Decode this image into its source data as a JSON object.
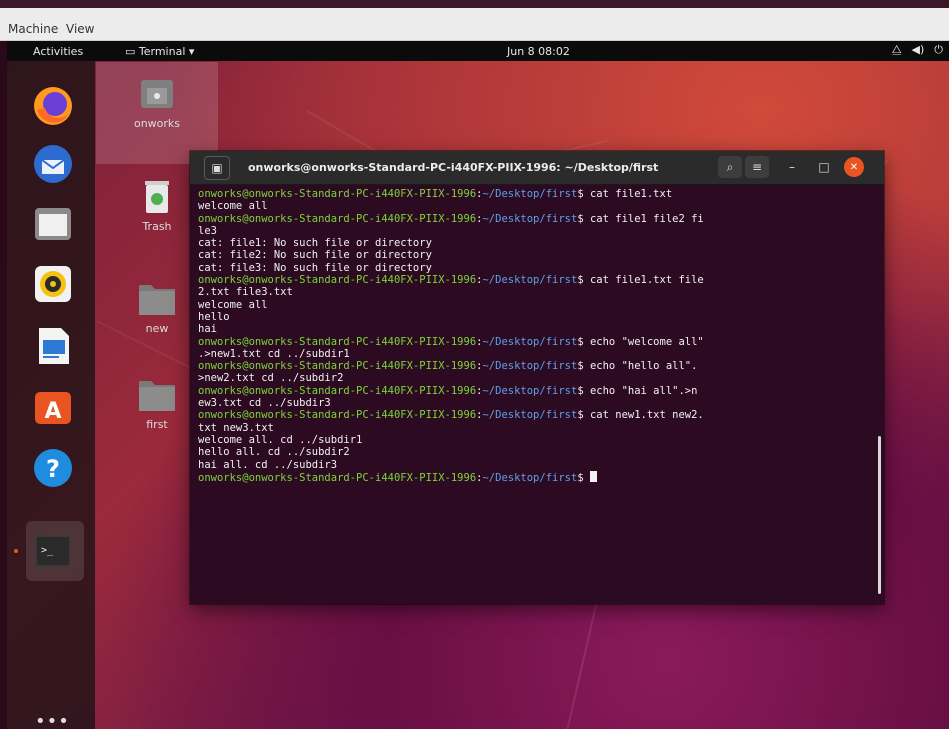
{
  "host_menu": {
    "machine": "Machine",
    "view": "View"
  },
  "topbar": {
    "activities": "Activities",
    "app_menu": "Terminal ▾",
    "clock": "Jun 8  08:02"
  },
  "desktop_icons": {
    "home": "onworks",
    "trash": "Trash",
    "new": "new",
    "first": "first"
  },
  "terminal": {
    "title": "onworks@onworks-Standard-PC-i440FX-PIIX-1996: ~/Desktop/first",
    "prompt_user": "onworks@onworks-Standard-PC-i440FX-PIIX-1996",
    "prompt_path": "~/Desktop/first",
    "lines": {
      "cmd1": "cat file1.txt",
      "out1": "welcome all",
      "cmd2": "cat file1 file2 fi",
      "cmd2b": "le3",
      "err1": "cat: file1: No such file or directory",
      "err2": "cat: file2: No such file or directory",
      "err3": "cat: file3: No such file or directory",
      "cmd3": "cat file1.txt file",
      "cmd3b": "2.txt file3.txt",
      "out2": "welcome all",
      "out3": "hello",
      "out4": "hai",
      "cmd4": "echo \"welcome all\"",
      "cmd4b": ".>new1.txt cd ../subdir1",
      "cmd5": "echo \"hello  all\".",
      "cmd5b": ">new2.txt cd ../subdir2",
      "cmd6": "echo \"hai  all\".>n",
      "cmd6b": "ew3.txt cd ../subdir3",
      "cmd7": "cat new1.txt new2.",
      "cmd7b": "txt new3.txt",
      "out5": "welcome all. cd ../subdir1",
      "out6": "hello  all. cd ../subdir2",
      "out7": "hai  all. cd ../subdir3"
    }
  },
  "colors": {
    "prompt_user": "#7dd43a",
    "prompt_path": "#5fa0e8",
    "terminal_bg": "#2c0b22",
    "close": "#e95420"
  }
}
